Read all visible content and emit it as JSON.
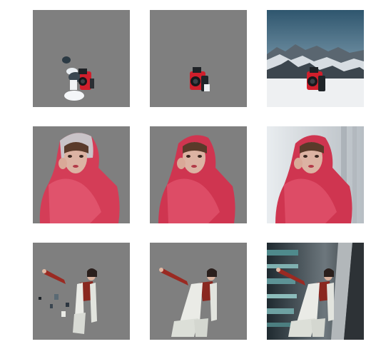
{
  "grid": {
    "rows": 3,
    "cols": 3,
    "matte_color": "#7f7f7f"
  },
  "rows": [
    {
      "subject": "red-camera-on-snow",
      "panels": [
        "coarse-mask-cutout",
        "refined-mask-cutout",
        "original-photo"
      ]
    },
    {
      "subject": "woman-in-red-scarf",
      "panels": [
        "coarse-mask-cutout",
        "refined-mask-cutout",
        "original-photo"
      ]
    },
    {
      "subject": "woman-in-white-outfit",
      "panels": [
        "coarse-mask-cutout",
        "refined-mask-cutout",
        "original-photo"
      ]
    }
  ]
}
